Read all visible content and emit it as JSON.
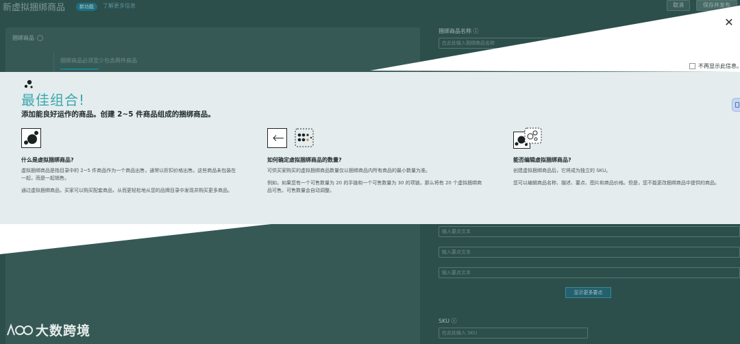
{
  "background_page": {
    "title": "新虚拟捆绑商品",
    "badge": "新功能",
    "learn_more": "了解更多信息",
    "cancel_label": "取消",
    "save_label": "保存并发布",
    "bundle_section_label": "捆绑商品",
    "bundle_hint": "捆绑商品必须至少包含两件商品",
    "name_label": "捆绑商品名称",
    "name_placeholder": "在此处输入捆绑商品名称",
    "bullet_placeholders": [
      "输入要点文本",
      "输入要点文本",
      "输入要点文本"
    ],
    "more_points_label": "显示更多要点",
    "sku_label": "SKU",
    "sku_placeholder": "在此处输入 SKU"
  },
  "modal": {
    "close_glyph": "✕",
    "dont_show_label": "不再显示此信息。",
    "hero_title": "最佳组合!",
    "hero_subtitle": "添加能良好运作的商品。创建 2~5 件商品组成的捆绑商品。",
    "columns": [
      {
        "icon": "bundle-dots-icon",
        "heading": "什么是虚拟捆绑商品?",
        "paragraphs": [
          "虚拟捆绑商品是指目录中的 2~5 件商品作为一个商品出售，通常以折扣价格出售。这些商品未包装在一起，而是一起销售。",
          "通过虚拟捆绑商品，买家可以购买配套商品，从而更轻松地从您的品牌目录中发现并购买更多商品。"
        ]
      },
      {
        "icon": "quantity-arrow-icon",
        "heading": "如何确定虚拟捆绑商品的数量?",
        "paragraphs": [
          "可供买家购买的虚拟捆绑商品数量仅以捆绑商品内所有商品的最小数量为准。",
          "例如，如果您有一个可售数量为 20 的手链和一个可售数量为 30 的项链，那么将有 20 个虚拟捆绑商品可售。可售数量会自动调整。"
        ]
      },
      {
        "icon": "edit-bundle-icon",
        "heading": "能否编辑虚拟捆绑商品?",
        "paragraphs": [
          "创建虚拟捆绑商品后，它将成为独立的 SKU。",
          "您可以编辑商品名称、描述、要点、图片和商品价格。但是，您不能更改捆绑商品中提供的商品。"
        ]
      }
    ]
  },
  "watermark": {
    "text": "大数跨境"
  },
  "colors": {
    "accent": "#3aa7ad",
    "banner_bg": "#e4ecee",
    "overlay_bg": "#2c4f4b"
  }
}
